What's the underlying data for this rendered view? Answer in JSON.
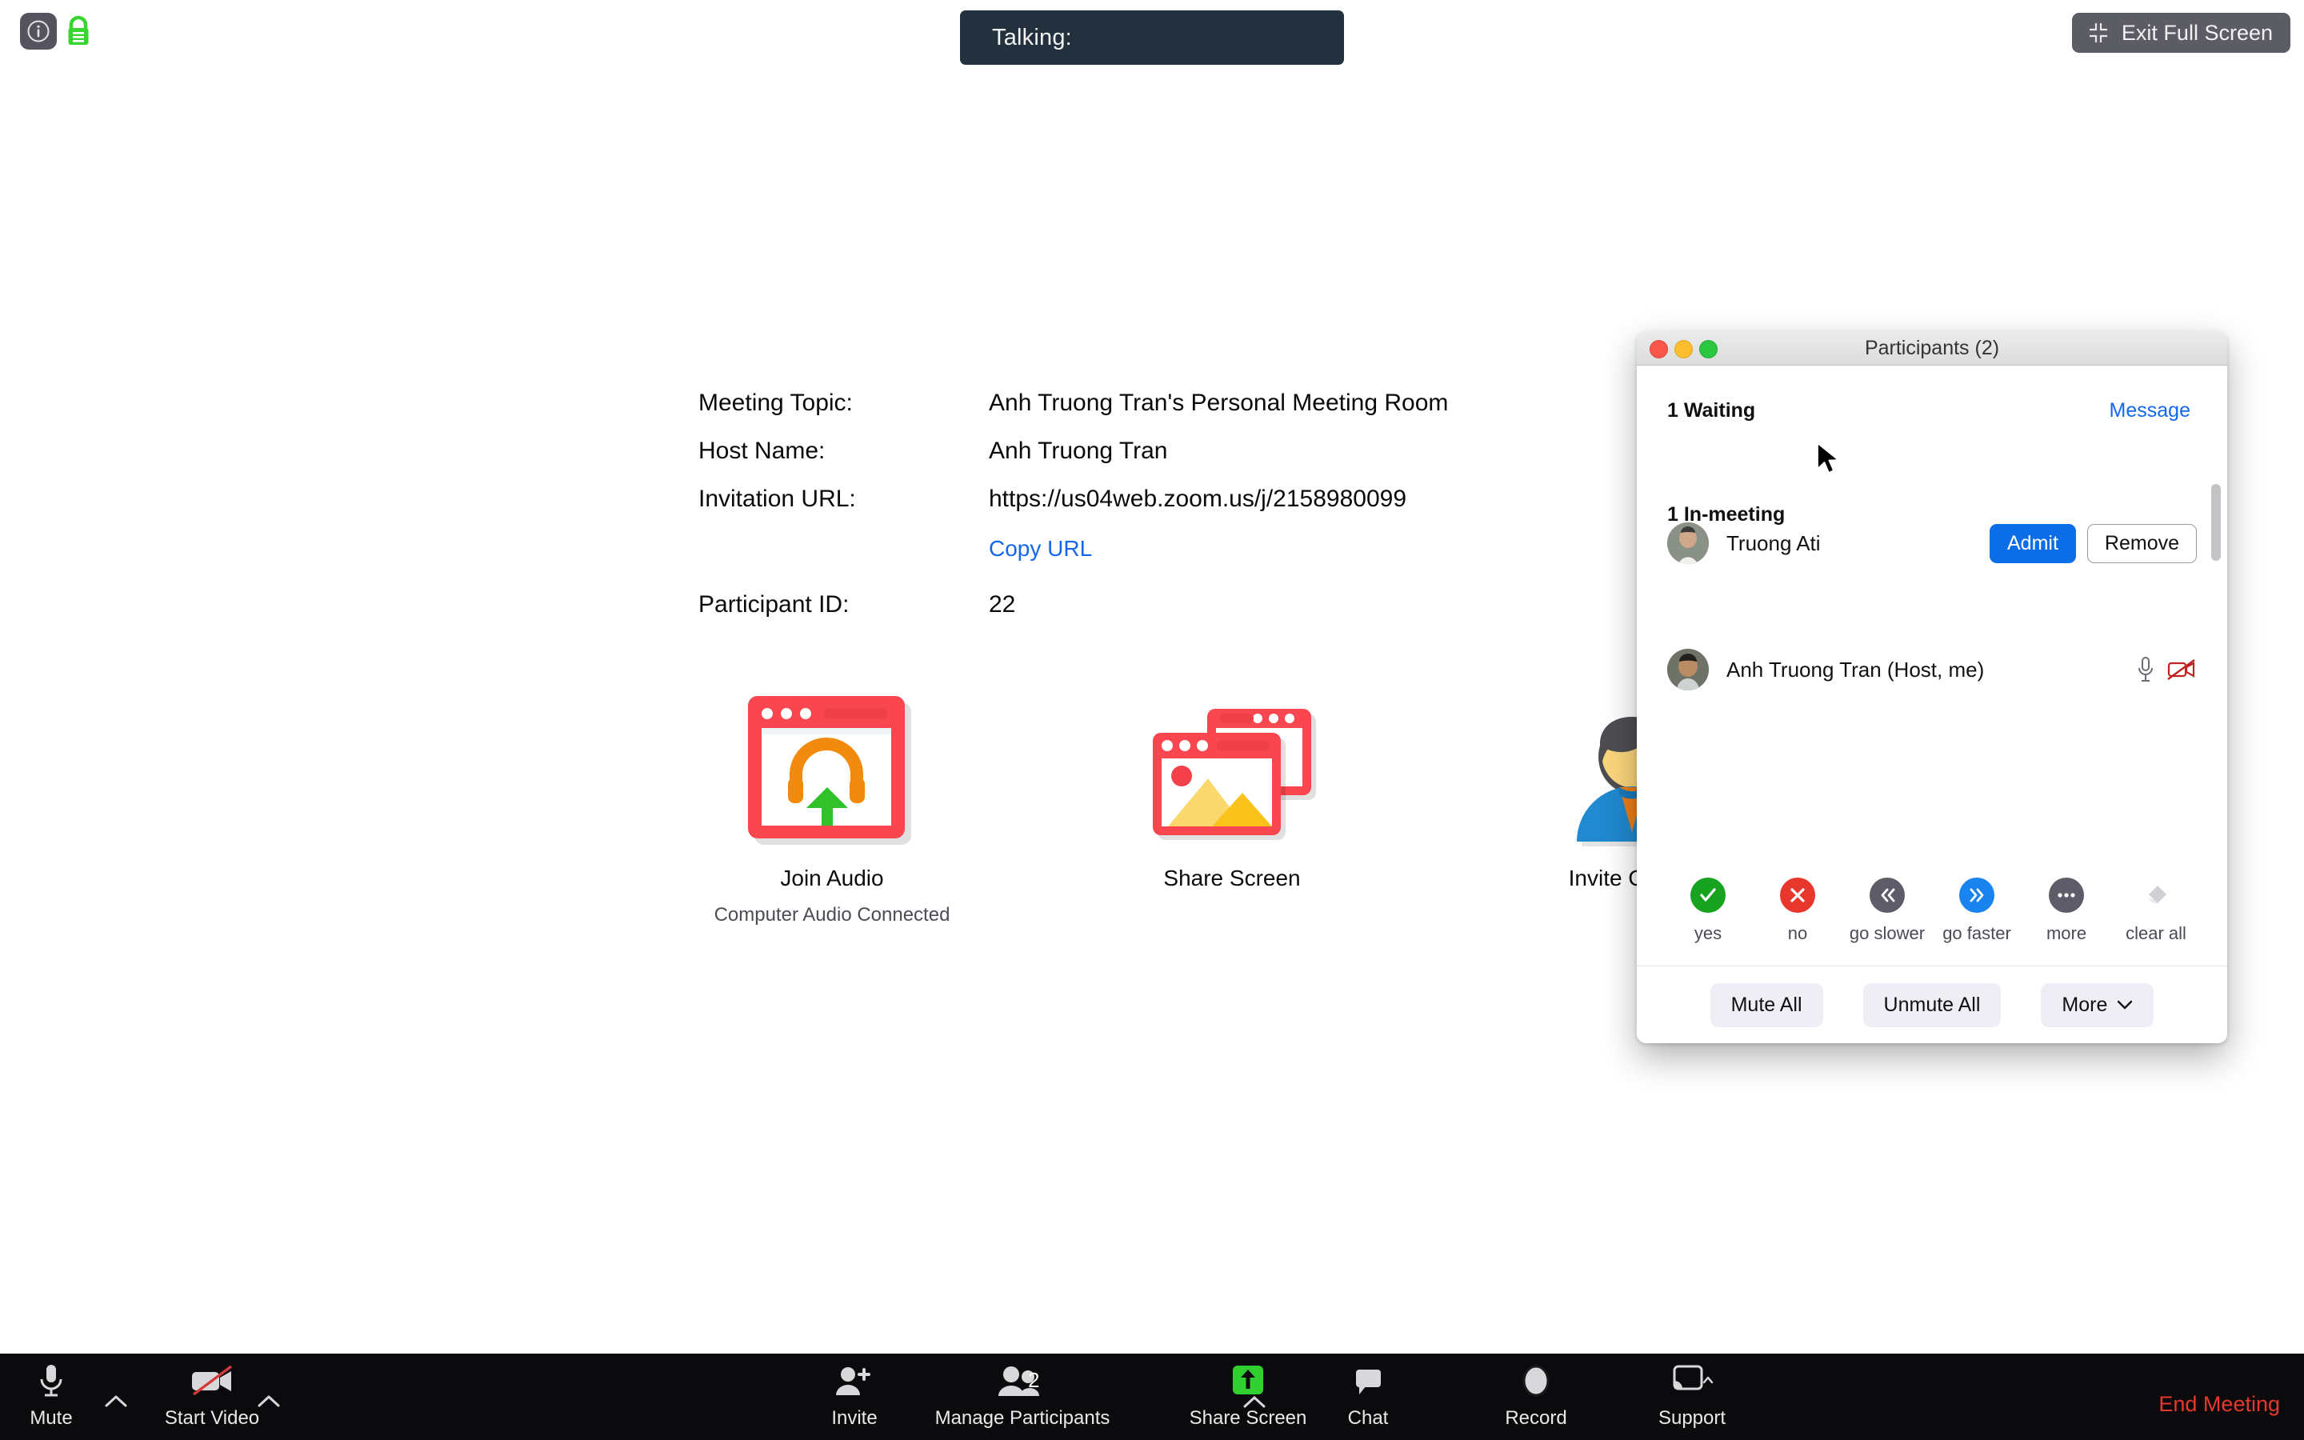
{
  "window_top": {
    "info_icon": "info-icon",
    "lock_icon": "lock-icon",
    "talking_label": "Talking:",
    "exit_fullscreen_label": "Exit Full Screen",
    "exit_fullscreen_icon": "contract-arrows-icon"
  },
  "meeting_info": {
    "rows": [
      {
        "label": "Meeting Topic:",
        "value": "Anh Truong Tran's Personal Meeting Room"
      },
      {
        "label": "Host Name:",
        "value": "Anh Truong Tran"
      },
      {
        "label": "Invitation URL:",
        "value": "https://us04web.zoom.us/j/2158980099"
      }
    ],
    "copy_url_label": "Copy URL",
    "participant_id_label": "Participant ID:",
    "participant_id_value": "22"
  },
  "actions": [
    {
      "caption": "Join Audio",
      "sub": "Computer Audio Connected",
      "icon": "join-audio-icon"
    },
    {
      "caption": "Share Screen",
      "sub": "",
      "icon": "share-screen-icon"
    },
    {
      "caption": "Invite Others",
      "sub": "",
      "icon": "invite-others-icon"
    }
  ],
  "participants_window": {
    "title": "Participants (2)",
    "waiting_section_title": "1 Waiting",
    "message_link": "Message",
    "waiting_participant": {
      "name": "Truong Ati",
      "admit_label": "Admit",
      "remove_label": "Remove"
    },
    "inmeeting_section_title": "1 In-meeting",
    "inmeeting_participant": {
      "name": "Anh Truong Tran (Host, me)",
      "mic_icon": "microphone-icon",
      "video_icon": "video-off-icon"
    },
    "feedback": [
      {
        "label": "yes",
        "icon": "check-icon",
        "color": "#17a320"
      },
      {
        "label": "no",
        "icon": "x-icon",
        "color": "#e8372c"
      },
      {
        "label": "go slower",
        "icon": "double-chevron-left-icon",
        "color": "#5d5c68"
      },
      {
        "label": "go faster",
        "icon": "double-chevron-right-icon",
        "color": "#1983f0"
      },
      {
        "label": "more",
        "icon": "ellipsis-icon",
        "color": "#5d5c68"
      },
      {
        "label": "clear all",
        "icon": "eraser-icon",
        "color": "#d2d2d8"
      }
    ],
    "footer_buttons": [
      {
        "label": "Mute All",
        "icon": ""
      },
      {
        "label": "Unmute All",
        "icon": ""
      },
      {
        "label": "More",
        "icon": "chevron-down-icon"
      }
    ]
  },
  "toolbar": {
    "items": [
      {
        "label": "Mute",
        "icon": "microphone-icon",
        "chevron": true,
        "badge": ""
      },
      {
        "label": "Start Video",
        "icon": "video-off-icon",
        "chevron": true,
        "badge": ""
      },
      {
        "label": "Invite",
        "icon": "person-add-icon",
        "chevron": false,
        "badge": ""
      },
      {
        "label": "Manage Participants",
        "icon": "people-icon",
        "chevron": false,
        "badge": "2"
      },
      {
        "label": "Share Screen",
        "icon": "share-arrow-up-icon",
        "chevron": true,
        "badge": ""
      },
      {
        "label": "Chat",
        "icon": "chat-bubble-icon",
        "chevron": false,
        "badge": ""
      },
      {
        "label": "Record",
        "icon": "record-circle-icon",
        "chevron": false,
        "badge": ""
      },
      {
        "label": "Support",
        "icon": "screen-cast-icon",
        "chevron": true,
        "badge": ""
      }
    ],
    "end_meeting_label": "End Meeting"
  },
  "colors": {
    "accent_blue": "#0b6ee8",
    "link_blue": "#1367ef",
    "end_red": "#e8372c",
    "banner_dark": "#22313d",
    "toolbar_black": "#0b0b0d",
    "lock_green": "#38d430"
  }
}
